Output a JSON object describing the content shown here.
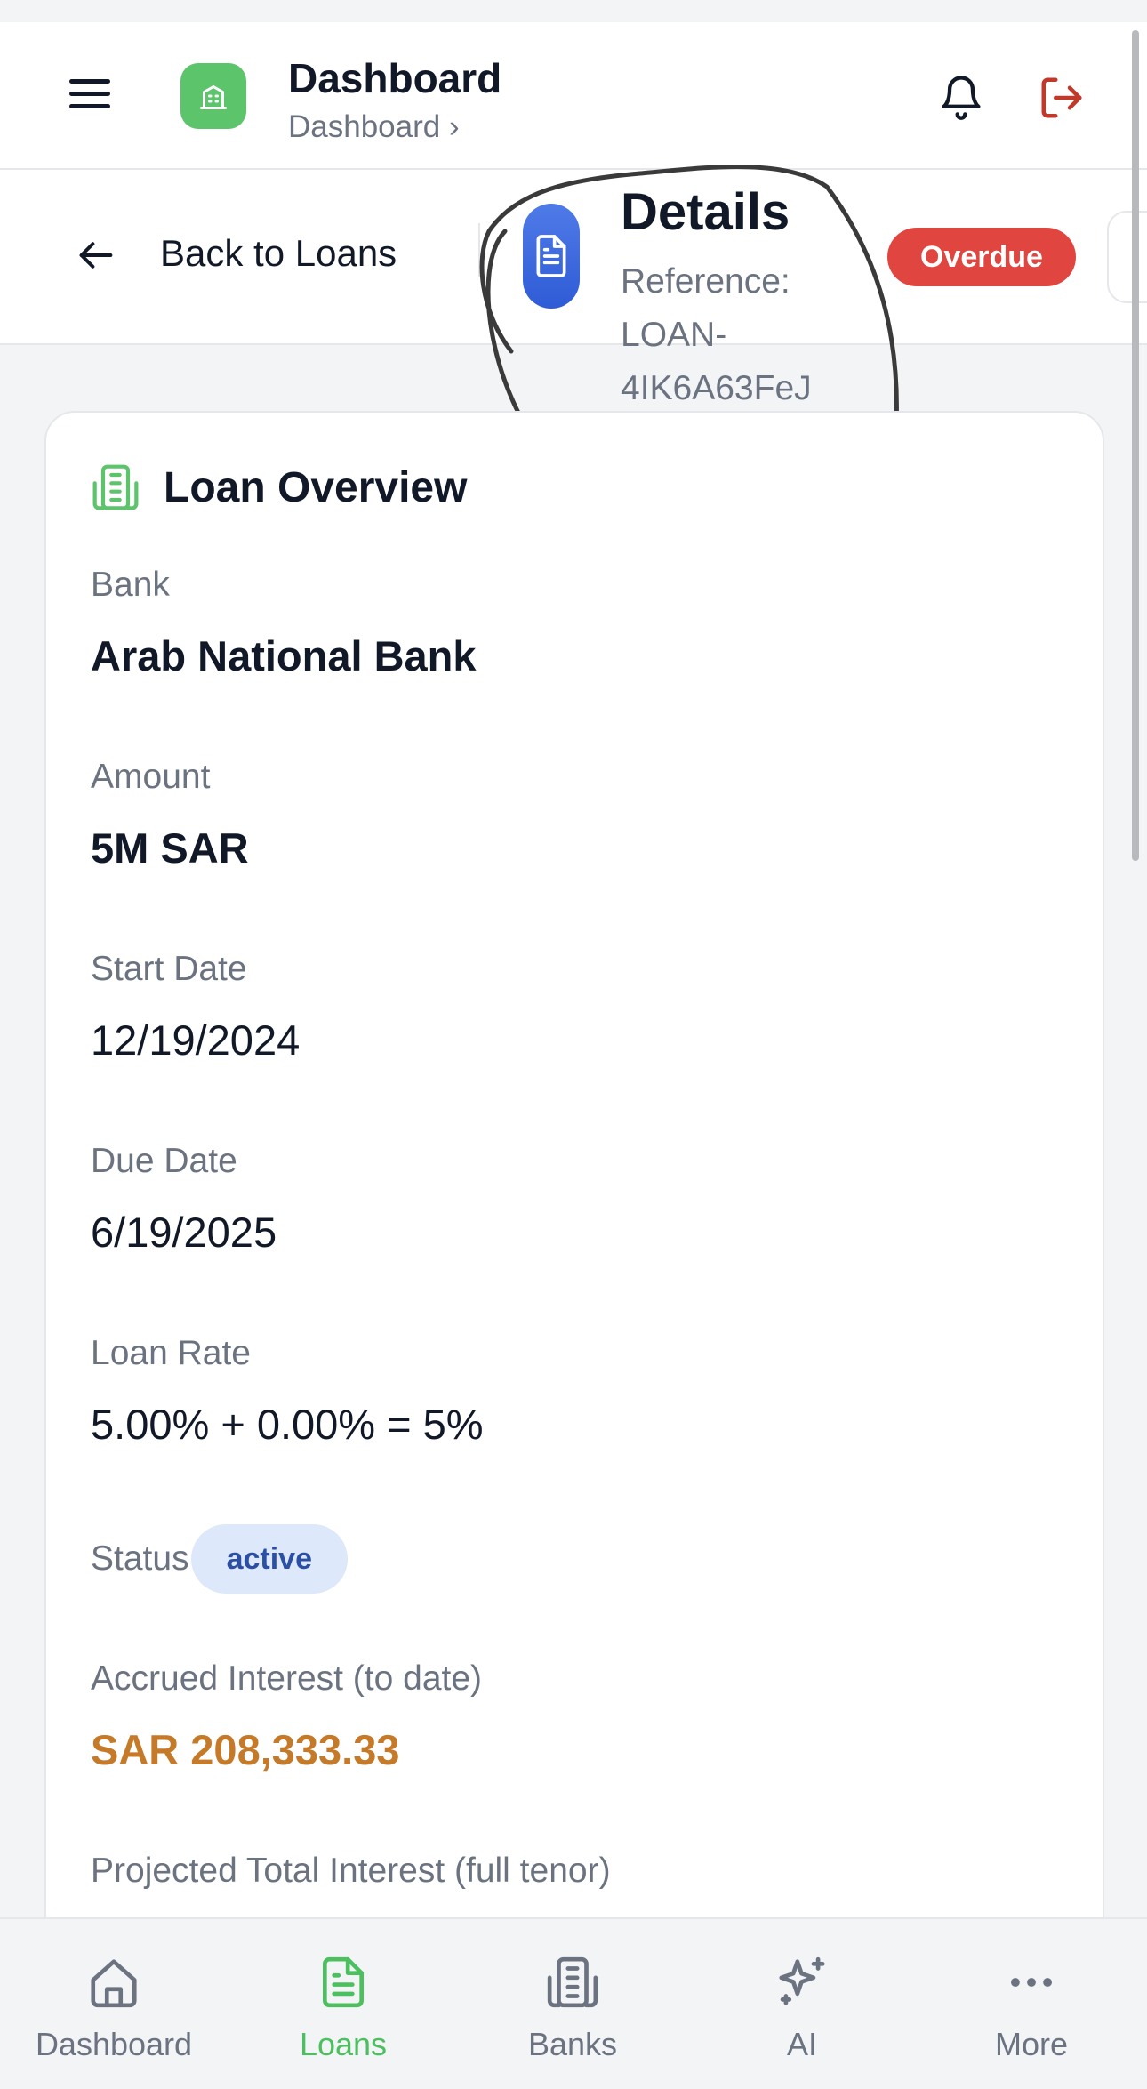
{
  "header": {
    "title": "Dashboard",
    "breadcrumb": "Dashboard ›"
  },
  "subheader": {
    "back_label": "Back to Loans",
    "title": "Details",
    "reference": "Reference: LOAN-4IK6A63FeJ",
    "badge": "Overdue"
  },
  "card": {
    "title": "Loan Overview",
    "fields": {
      "bank_label": "Bank",
      "bank_value": "Arab National Bank",
      "amount_label": "Amount",
      "amount_value": "5M SAR",
      "start_label": "Start Date",
      "start_value": "12/19/2024",
      "due_label": "Due Date",
      "due_value": "6/19/2025",
      "rate_label": "Loan Rate",
      "rate_value": "5.00% + 0.00% = 5%",
      "status_label": "Status",
      "status_value": "active",
      "accrued_label": "Accrued Interest (to date)",
      "accrued_value": "SAR 208,333.33",
      "projected_label": "Projected Total Interest (full tenor)"
    }
  },
  "bottom_nav": {
    "items": [
      {
        "label": "Dashboard",
        "icon": "home-icon"
      },
      {
        "label": "Loans",
        "icon": "document-icon",
        "active": true
      },
      {
        "label": "Banks",
        "icon": "building-icon"
      },
      {
        "label": "AI",
        "icon": "sparkles-icon"
      },
      {
        "label": "More",
        "icon": "more-icon"
      }
    ]
  },
  "colors": {
    "brand_green": "#5cc46a",
    "overdue_red": "#e0463f",
    "accrued_orange": "#c57a2a",
    "doc_blue": "#2f5bd6",
    "active_pill_bg": "#dde8fb"
  }
}
